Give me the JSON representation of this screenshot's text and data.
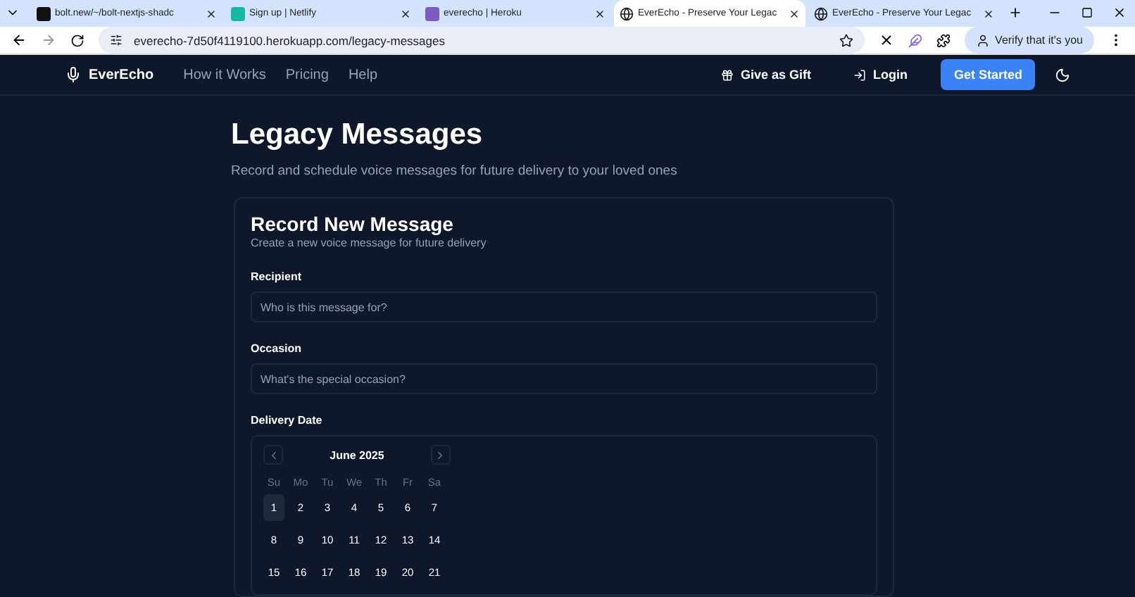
{
  "browser": {
    "tabs": [
      {
        "title": "bolt.new/~/bolt-nextjs-shadc",
        "kind": "bolt",
        "selected": false
      },
      {
        "title": "Sign up | Netlify",
        "kind": "netlify",
        "selected": false
      },
      {
        "title": "everecho | Heroku",
        "kind": "heroku",
        "selected": false
      },
      {
        "title": "EverEcho - Preserve Your Legac",
        "kind": "globe",
        "selected": true
      },
      {
        "title": "EverEcho - Preserve Your Legac",
        "kind": "globe",
        "selected": false
      }
    ],
    "url": "everecho-7d50f4119100.herokuapp.com/legacy-messages",
    "profile_button": "Verify that it's you"
  },
  "nav": {
    "brand": "EverEcho",
    "links": [
      "How it Works",
      "Pricing",
      "Help"
    ],
    "gift": "Give as Gift",
    "login": "Login",
    "cta": "Get Started"
  },
  "page": {
    "title": "Legacy Messages",
    "subtitle": "Record and schedule voice messages for future delivery to your loved ones"
  },
  "card": {
    "title": "Record New Message",
    "subtitle": "Create a new voice message for future delivery",
    "fields": [
      {
        "label": "Recipient",
        "placeholder": "Who is this message for?"
      },
      {
        "label": "Occasion",
        "placeholder": "What's the special occasion?"
      }
    ],
    "date_label": "Delivery Date",
    "calendar": {
      "month": "June 2025",
      "weekdays": [
        "Su",
        "Mo",
        "Tu",
        "We",
        "Th",
        "Fr",
        "Sa"
      ],
      "weeks": [
        [
          {
            "day": "1",
            "selected": true
          },
          {
            "day": "2",
            "selected": false
          },
          {
            "day": "3",
            "selected": false
          },
          {
            "day": "4",
            "selected": false
          },
          {
            "day": "5",
            "selected": false
          },
          {
            "day": "6",
            "selected": false
          },
          {
            "day": "7",
            "selected": false
          }
        ],
        [
          {
            "day": "8",
            "selected": false
          },
          {
            "day": "9",
            "selected": false
          },
          {
            "day": "10",
            "selected": false
          },
          {
            "day": "11",
            "selected": false
          },
          {
            "day": "12",
            "selected": false
          },
          {
            "day": "13",
            "selected": false
          },
          {
            "day": "14",
            "selected": false
          }
        ],
        [
          {
            "day": "15",
            "selected": false
          },
          {
            "day": "16",
            "selected": false
          },
          {
            "day": "17",
            "selected": false
          },
          {
            "day": "18",
            "selected": false
          },
          {
            "day": "19",
            "selected": false
          },
          {
            "day": "20",
            "selected": false
          },
          {
            "day": "21",
            "selected": false
          }
        ]
      ]
    }
  }
}
